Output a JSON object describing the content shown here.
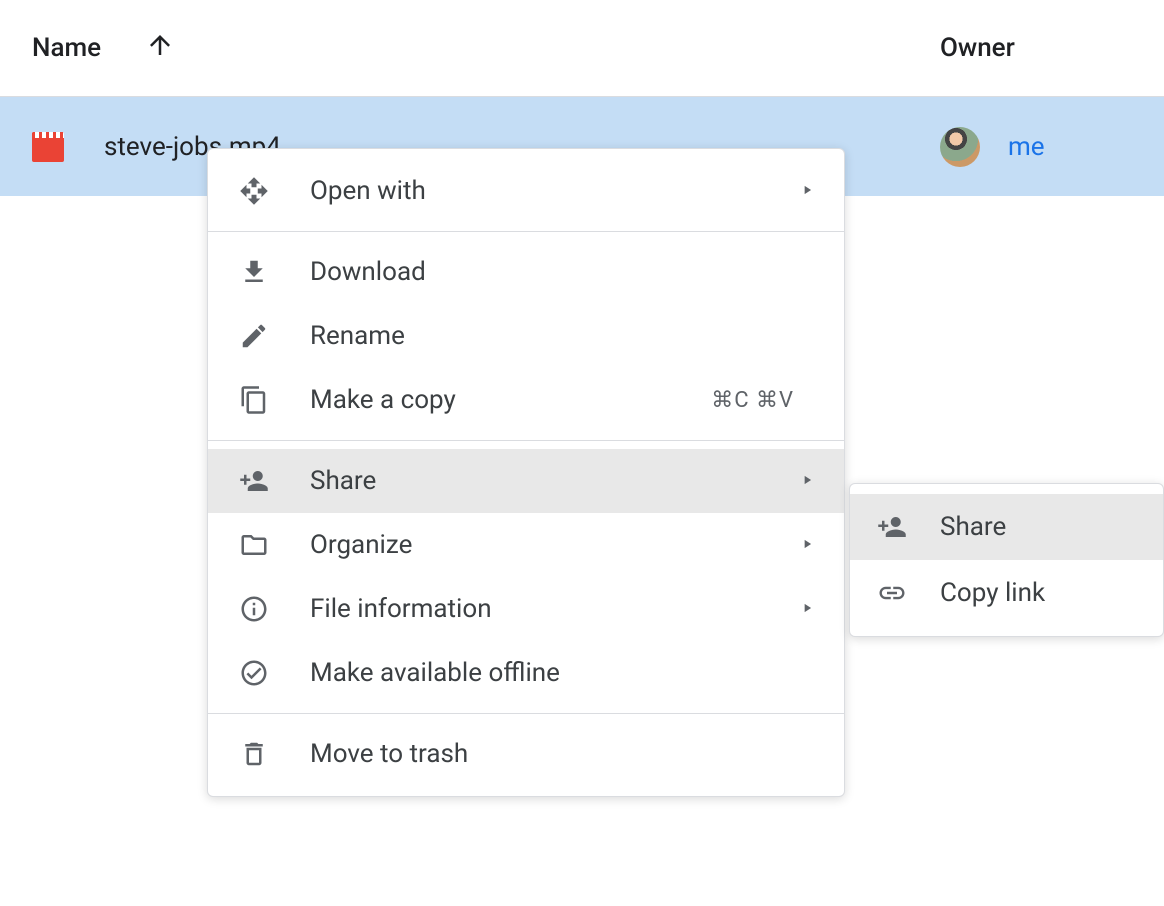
{
  "header": {
    "col_name": "Name",
    "col_owner": "Owner"
  },
  "file": {
    "name": "steve-jobs.mp4",
    "owner": "me"
  },
  "menu": {
    "open_with": "Open with",
    "download": "Download",
    "rename": "Rename",
    "make_copy": "Make a copy",
    "make_copy_shortcut": "⌘C ⌘V",
    "share": "Share",
    "organize": "Organize",
    "file_info": "File information",
    "offline": "Make available offline",
    "trash": "Move to trash"
  },
  "submenu": {
    "share": "Share",
    "copy_link": "Copy link"
  }
}
